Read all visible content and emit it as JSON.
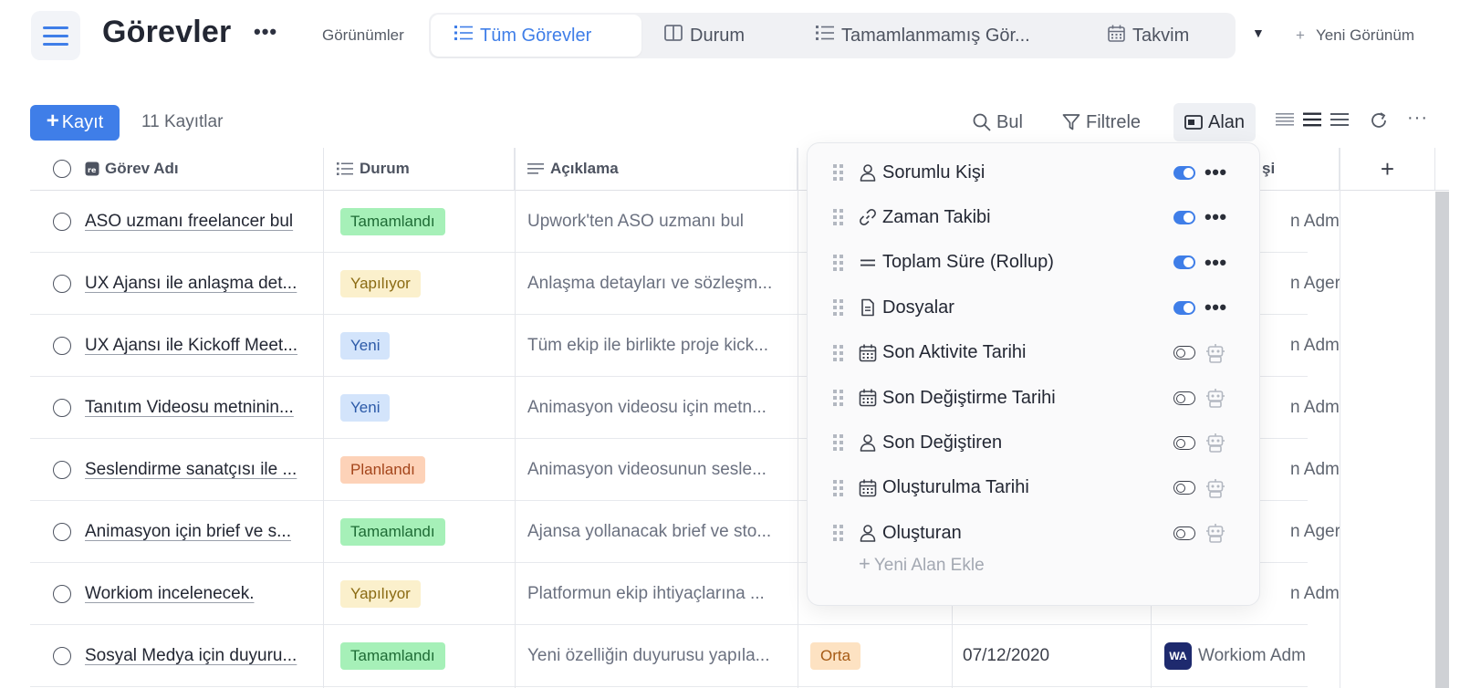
{
  "header": {
    "title": "Görevler",
    "views_label": "Görünümler",
    "tabs": [
      {
        "label": "Tüm Görevler",
        "icon": "list-icon",
        "active": true
      },
      {
        "label": "Durum",
        "icon": "board-icon",
        "active": false
      },
      {
        "label": "Tamamlanmamış Gör...",
        "icon": "list-icon",
        "active": false
      },
      {
        "label": "Takvim",
        "icon": "calendar-icon",
        "active": false
      }
    ],
    "new_view_label": "Yeni Görünüm"
  },
  "toolbar": {
    "add_label": "Kayıt",
    "record_count": "11 Kayıtlar",
    "find_label": "Bul",
    "filter_label": "Filtrele",
    "fields_label": "Alan"
  },
  "table": {
    "columns": {
      "name": "Görev Adı",
      "status": "Durum",
      "description": "Açıklama",
      "person_partial": "şi"
    },
    "rows": [
      {
        "name": "ASO uzmanı freelancer bul",
        "status": "Tamamlandı",
        "description": "Upwork'ten ASO uzmanı bul",
        "person": "n Adm"
      },
      {
        "name": "UX Ajansı ile anlaşma det...",
        "status": "Yapılıyor",
        "description": "Anlaşma detayları ve sözleşm...",
        "person": "n Ager"
      },
      {
        "name": "UX Ajansı ile Kickoff Meet...",
        "status": "Yeni",
        "description": "Tüm ekip ile birlikte proje kick...",
        "person": "n Adm"
      },
      {
        "name": "Tanıtım Videosu metninin...",
        "status": "Yeni",
        "description": "Animasyon videosu için metn...",
        "person": "n Adm"
      },
      {
        "name": "Seslendirme sanatçısı ile ...",
        "status": "Planlandı",
        "description": "Animasyon videosunun sesle...",
        "person": "n Adm"
      },
      {
        "name": "Animasyon için brief ve s...",
        "status": "Tamamlandı",
        "description": "Ajansa yollanacak brief ve sto...",
        "person": "n Ager"
      },
      {
        "name": "Workiom incelenecek.",
        "status": "Yapılıyor",
        "description": "Platformun ekip ihtiyaçlarına ...",
        "person": "n Adm"
      },
      {
        "name": "Sosyal Medya için duyuru...",
        "status": "Tamamlandı",
        "description": "Yeni özelliğin duyurusu yapıla...",
        "priority": "Orta",
        "date": "07/12/2020",
        "avatar": "WA",
        "person": "Workiom Adm"
      }
    ]
  },
  "status_colors": {
    "Tamamlandı": {
      "bg": "#a6f0b8",
      "fg": "#1e6b35"
    },
    "Yapılıyor": {
      "bg": "#fbf0cc",
      "fg": "#8a6a12"
    },
    "Yeni": {
      "bg": "#d3e4fb",
      "fg": "#2c5aa8"
    },
    "Planlandı": {
      "bg": "#fdd2b8",
      "fg": "#a4451b"
    },
    "Orta": {
      "bg": "#fde2c2",
      "fg": "#a55a14"
    }
  },
  "fields_popover": {
    "fields": [
      {
        "label": "Sorumlu Kişi",
        "icon": "person-icon",
        "visible": true
      },
      {
        "label": "Zaman Takibi",
        "icon": "link-icon",
        "visible": true
      },
      {
        "label": "Toplam Süre (Rollup)",
        "icon": "equals-icon",
        "visible": true
      },
      {
        "label": "Dosyalar",
        "icon": "file-icon",
        "visible": true
      },
      {
        "label": "Son Aktivite Tarihi",
        "icon": "calendar-icon",
        "visible": false
      },
      {
        "label": "Son Değiştirme Tarihi",
        "icon": "calendar-icon",
        "visible": false
      },
      {
        "label": "Son Değiştiren",
        "icon": "person-icon",
        "visible": false
      },
      {
        "label": "Oluşturulma Tarihi",
        "icon": "calendar-icon",
        "visible": false
      },
      {
        "label": "Oluşturan",
        "icon": "person-icon",
        "visible": false
      }
    ],
    "add_field_label": "Yeni Alan Ekle"
  },
  "colors": {
    "accent": "#3f7ee8"
  }
}
